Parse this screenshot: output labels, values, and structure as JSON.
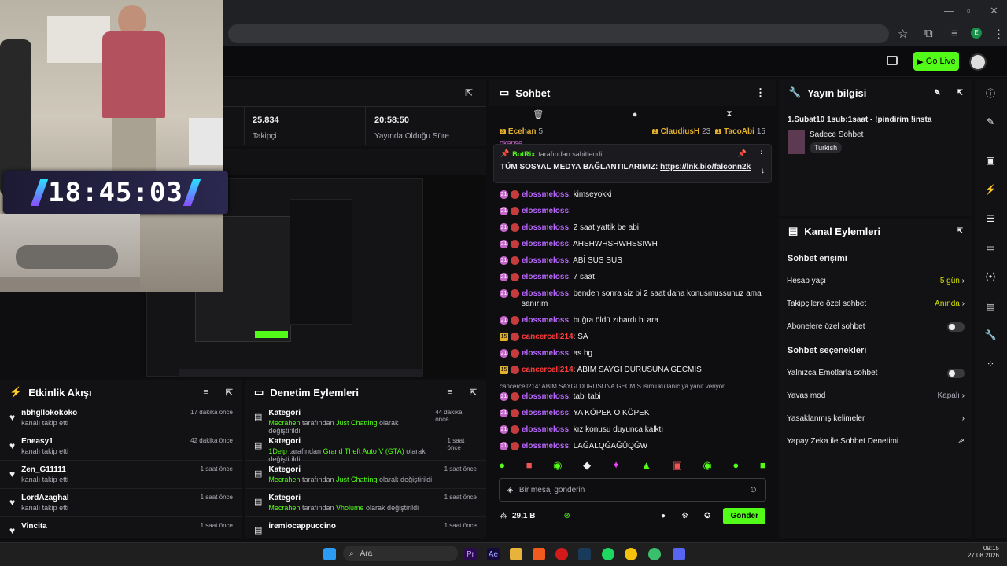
{
  "stats": {
    "followers_value": "25.834",
    "followers_label": "Takipçi",
    "uptime_value": "20:58:50",
    "uptime_label": "Yayında Olduğu Süre"
  },
  "timer": "18:45:03",
  "go_live_label": "Go Live",
  "chat": {
    "title": "Sohbet",
    "top_gifters": [
      {
        "badge": "3",
        "name": "Ecehan",
        "count": "5"
      },
      {
        "badge": "2",
        "name": "ClaudiusH",
        "count": "23"
      },
      {
        "badge": "1",
        "name": "TacoAbi",
        "count": "15"
      }
    ],
    "partial_user": "okanse",
    "pinned_by_user": "BotRix",
    "pinned_by_suffix": "tarafından sabitlendi",
    "pinned_text": "TÜM SOSYAL MEDYA BAĞLANTILARIMIZ:",
    "pinned_link": "https://lnk.bio/falconn2k",
    "messages": [
      {
        "badge": "21",
        "user": "elossmeloss",
        "text": "kimseyokki",
        "color": "purple"
      },
      {
        "badge": "21",
        "user": "elossmeloss",
        "text": "",
        "color": "purple"
      },
      {
        "badge": "21",
        "user": "elossmeloss",
        "text": "2 saat yattik be abi",
        "color": "purple"
      },
      {
        "badge": "21",
        "user": "elossmeloss",
        "text": "AHSHWHSHWHSSIWH",
        "color": "purple"
      },
      {
        "badge": "21",
        "user": "elossmeloss",
        "text": "ABİ SUS SUS",
        "color": "purple"
      },
      {
        "badge": "21",
        "user": "elossmeloss",
        "text": "7 saat",
        "color": "purple"
      },
      {
        "badge": "21",
        "user": "elossmeloss",
        "text": "benden sonra siz bi 2 saat daha konusmussunuz ama sanırım",
        "color": "purple"
      },
      {
        "badge": "21",
        "user": "elossmeloss",
        "text": "buğra öldü zıbardı bi ara",
        "color": "purple"
      },
      {
        "badge": "15",
        "user": "cancercell214",
        "text": "SA",
        "color": "red"
      },
      {
        "badge": "21",
        "user": "elossmeloss",
        "text": "as hg",
        "color": "purple"
      },
      {
        "badge": "15",
        "user": "cancercell214",
        "text": "ABIM SAYGI DURUSUNA GECMIS",
        "color": "red"
      }
    ],
    "reply_note": "cancercell214: ABIM SAYGI DURUSUNA GECMIS isimli kullanıcıya yanıt veriyor",
    "messages2": [
      {
        "badge": "21",
        "user": "elossmeloss",
        "text": "tabi tabi"
      },
      {
        "badge": "21",
        "user": "elossmeloss",
        "text": "YA KÖPEK O KÖPEK"
      },
      {
        "badge": "21",
        "user": "elossmeloss",
        "text": "kız konusu duyunca kalktı"
      },
      {
        "badge": "21",
        "user": "elossmeloss",
        "text": "LAĞALQĞAĞÜQĞW"
      }
    ],
    "input_placeholder": "Bir mesaj gönderin",
    "points": "29,1 B",
    "send_label": "Gönder"
  },
  "stream_info": {
    "title": "Yayın bilgisi",
    "stream_title": "1.Subat10 1sub:1saat - !pindirim !insta",
    "category": "Sadece Sohbet",
    "tag": "Turkish"
  },
  "channel_actions": {
    "title": "Kanal Eylemleri",
    "chat_access_heading": "Sohbet erişimi",
    "account_age_label": "Hesap yaşı",
    "account_age_value": "5 gün",
    "followers_only_label": "Takipçilere özel sohbet",
    "followers_only_value": "Anında",
    "subs_only_label": "Abonelere özel sohbet",
    "chat_options_heading": "Sohbet seçenekleri",
    "emote_only_label": "Yalnızca Emotlarla sohbet",
    "slow_mode_label": "Yavaş mod",
    "slow_mode_value": "Kapalı",
    "banned_words_label": "Yasaklanmış kelimeler",
    "ai_moderation_label": "Yapay Zeka ile Sohbet Denetimi"
  },
  "activity_feed": {
    "title": "Etkinlik Akışı",
    "items": [
      {
        "name": "nbhgllokokoko",
        "sub": "kanalı takip etti",
        "time": "17 dakika önce"
      },
      {
        "name": "Eneasy1",
        "sub": "kanalı takip etti",
        "time": "42 dakika önce"
      },
      {
        "name": "Zen_G11111",
        "sub": "kanalı takip etti",
        "time": "1 saat önce"
      },
      {
        "name": "LordAzaghal",
        "sub": "kanalı takip etti",
        "time": "1 saat önce"
      },
      {
        "name": "Vincita",
        "sub": "",
        "time": "1 saat önce"
      }
    ]
  },
  "mod_actions": {
    "title": "Denetim Eylemleri",
    "items": [
      {
        "title": "Kategori",
        "user": "Mecrahen",
        "mid": "tarafından",
        "target": "Just Chatting",
        "tail": "olarak değiştirildi",
        "time": "44 dakika önce"
      },
      {
        "title": "Kategori",
        "user": "1Deip",
        "mid": "tarafından",
        "target": "Grand Theft Auto V (GTA)",
        "tail": "olarak değiştirildi",
        "time": "1 saat önce"
      },
      {
        "title": "Kategori",
        "user": "Mecrahen",
        "mid": "tarafından",
        "target": "Just Chatting",
        "tail": "olarak değiştirildi",
        "time": "1 saat önce"
      },
      {
        "title": "Kategori",
        "user": "Mecrahen",
        "mid": "tarafından",
        "target": "Vholume",
        "tail": "olarak değiştirildi",
        "time": "1 saat önce"
      },
      {
        "title": "iremiocappuccino",
        "user": "",
        "mid": "",
        "target": "",
        "tail": "",
        "time": "1 saat önce"
      }
    ]
  },
  "taskbar": {
    "search_placeholder": "Ara",
    "time": "09:15",
    "date": "27.08.2026"
  },
  "colors": {
    "accent": "#53fc18",
    "chat_purple": "#b967ff",
    "chat_red": "#ff3b3b"
  }
}
